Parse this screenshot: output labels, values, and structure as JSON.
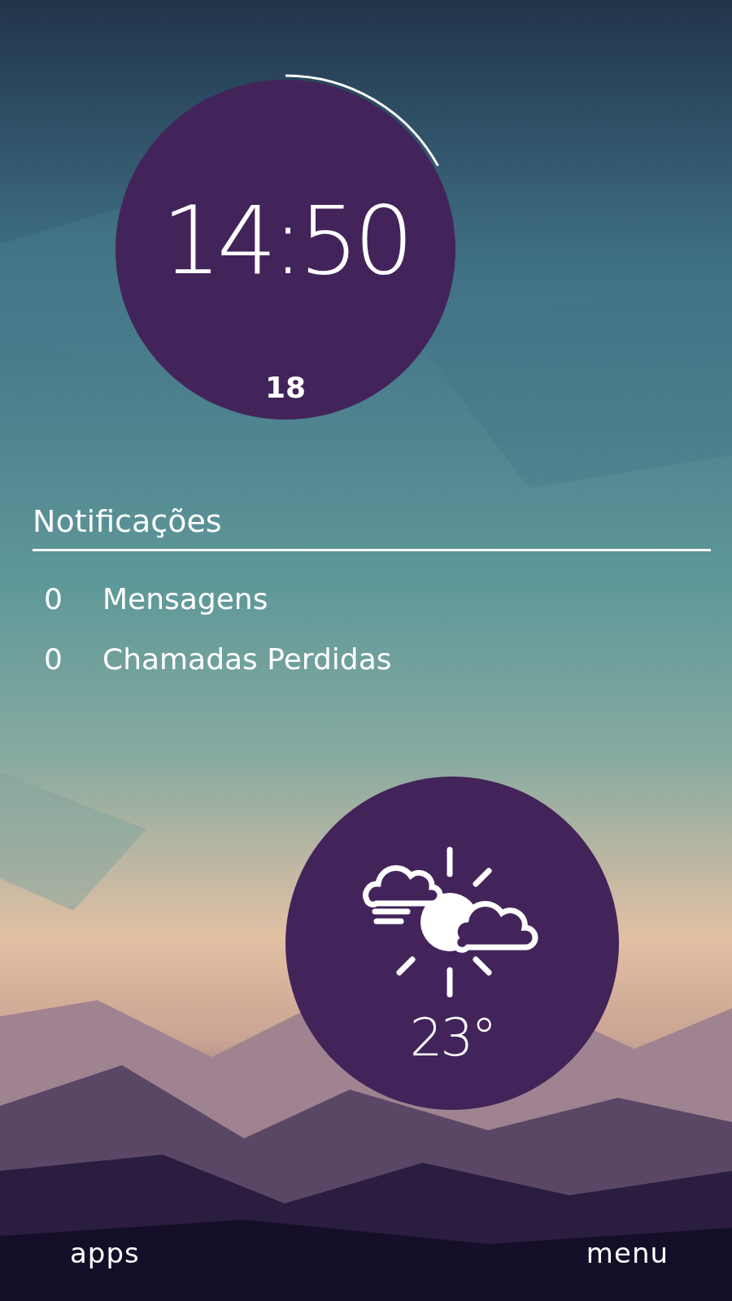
{
  "clock": {
    "time": "14:50",
    "date": "18"
  },
  "notifications": {
    "title": "Notificações",
    "items": [
      {
        "count": "0",
        "label": "Mensagens"
      },
      {
        "count": "0",
        "label": "Chamadas Perdidas"
      }
    ]
  },
  "weather": {
    "temperature": "23°"
  },
  "bottom_bar": {
    "left": "apps",
    "right": "menu"
  }
}
